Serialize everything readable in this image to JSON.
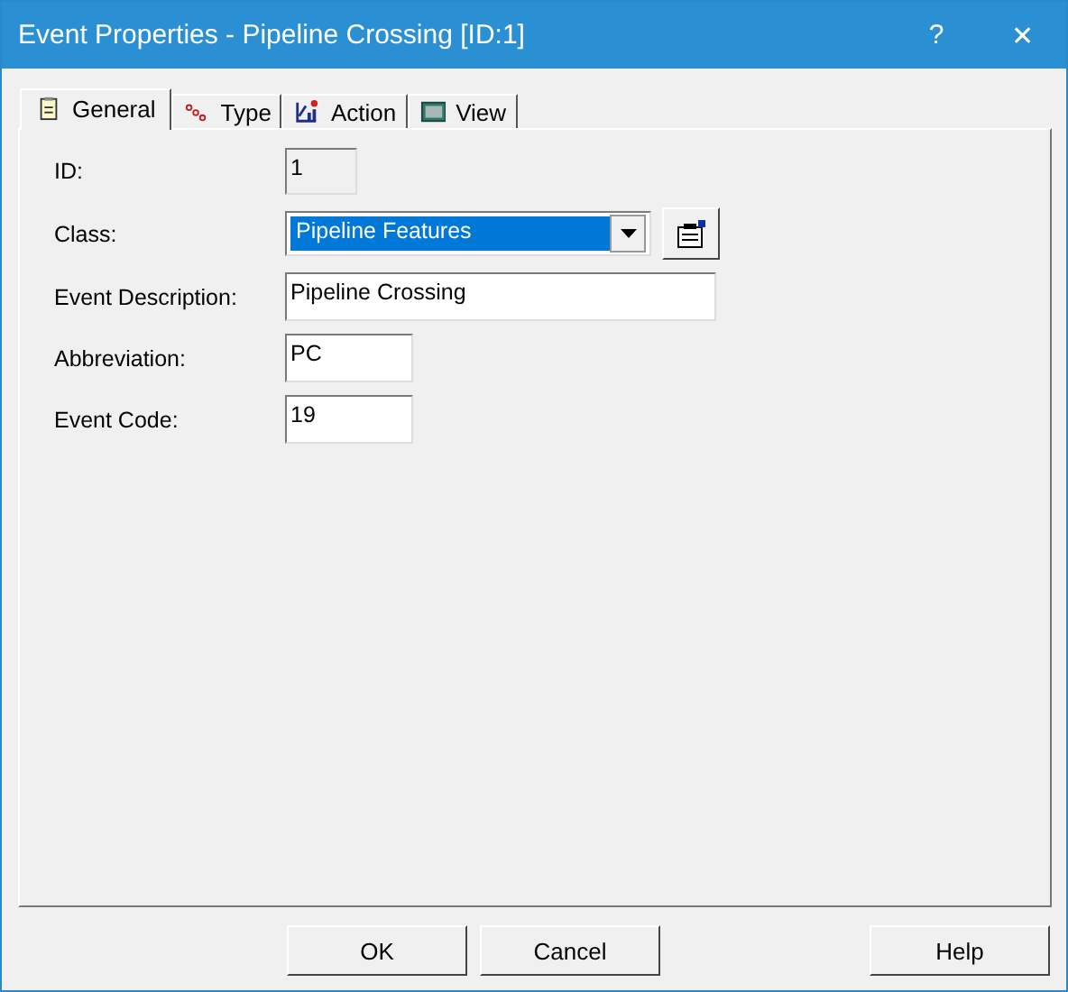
{
  "window": {
    "title": "Event Properties - Pipeline Crossing [ID:1]",
    "help": "?",
    "close": "✕"
  },
  "tabs": [
    {
      "label": "General",
      "kind": "general",
      "selected": true
    },
    {
      "label": "Type",
      "kind": "type",
      "selected": false
    },
    {
      "label": "Action",
      "kind": "action",
      "selected": false
    },
    {
      "label": "View",
      "kind": "view",
      "selected": false
    }
  ],
  "fields": [
    {
      "label": "ID:",
      "kind": "readonly",
      "value": "1"
    },
    {
      "label": "Class:",
      "kind": "combo",
      "value": "Pipeline Features",
      "selected": true
    },
    {
      "label": "Event Description:",
      "kind": "wide",
      "value": "Pipeline Crossing"
    },
    {
      "label": "Abbreviation:",
      "kind": "short",
      "value": "PC"
    },
    {
      "label": "Event Code:",
      "kind": "short",
      "value": "19"
    }
  ],
  "buttons": [
    {
      "label": "OK",
      "kind": "left"
    },
    {
      "label": "Cancel",
      "kind": "left"
    },
    {
      "label": "Help",
      "kind": "right"
    }
  ]
}
